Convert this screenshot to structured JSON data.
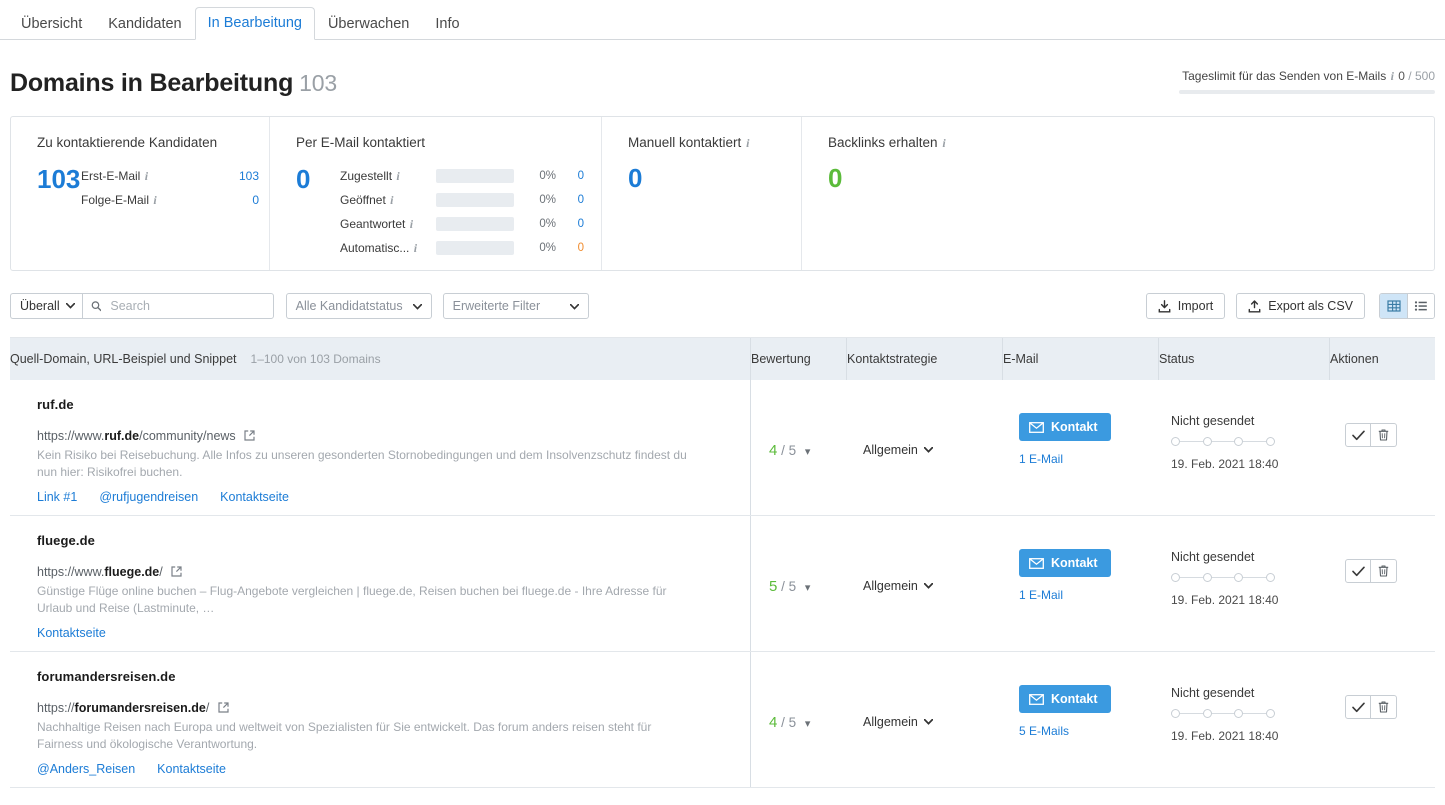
{
  "tabs": [
    {
      "label": "Übersicht",
      "active": false
    },
    {
      "label": "Kandidaten",
      "active": false
    },
    {
      "label": "In Bearbeitung",
      "active": true
    },
    {
      "label": "Überwachen",
      "active": false
    },
    {
      "label": "Info",
      "active": false
    }
  ],
  "header": {
    "title": "Domains in Bearbeitung",
    "count": "103",
    "daily_limit_label": "Tageslimit für das Senden von E-Mails",
    "daily_limit_value": "0",
    "daily_limit_sep": "/",
    "daily_limit_total": "500"
  },
  "stats": {
    "to_contact": {
      "title": "Zu kontaktierende Kandidaten",
      "big": "103",
      "rows": [
        {
          "label": "Erst-E-Mail",
          "value": "103"
        },
        {
          "label": "Folge-E-Mail",
          "value": "0"
        }
      ]
    },
    "by_email": {
      "title": "Per E-Mail kontaktiert",
      "big": "0",
      "rows": [
        {
          "label": "Zugestellt",
          "pct": "0%",
          "value": "0",
          "orange": false
        },
        {
          "label": "Geöffnet",
          "pct": "0%",
          "value": "0",
          "orange": false
        },
        {
          "label": "Geantwortet",
          "pct": "0%",
          "value": "0",
          "orange": false
        },
        {
          "label": "Automatisc...",
          "pct": "0%",
          "value": "0",
          "orange": true
        }
      ]
    },
    "manual": {
      "title": "Manuell kontaktiert",
      "big": "0"
    },
    "backlinks": {
      "title": "Backlinks erhalten",
      "big": "0"
    }
  },
  "toolbar": {
    "scope_label": "Überall",
    "search_placeholder": "Search",
    "search_value": "",
    "status_filter": "Alle Kandidatstatus",
    "advanced_filter": "Erweiterte Filter",
    "import_label": "Import",
    "export_label": "Export als CSV",
    "view_grid": "grid-view",
    "view_list": "list-view"
  },
  "table": {
    "columns": {
      "domain": "Quell-Domain, URL-Beispiel und Snippet",
      "domain_sub": "1–100 von 103 Domains",
      "rating": "Bewertung",
      "strategy": "Kontaktstrategie",
      "email": "E-Mail",
      "status": "Status",
      "actions": "Aktionen"
    },
    "rows": [
      {
        "domain": "ruf.de",
        "url_prefix": "https://www.",
        "url_bold": "ruf.de",
        "url_suffix": "/community/news",
        "snippet": "Kein Risiko bei Reisebuchung. Alle Infos zu unseren gesonderten Stornobedingungen und dem Insolvenzschutz findest du nun hier: Risikofrei buchen.",
        "links": [
          "Link #1",
          "@rufjugendreisen",
          "Kontaktseite"
        ],
        "rating_value": "4",
        "rating_max": "/ 5",
        "strategy": "Allgemein",
        "contact_label": "Kontakt",
        "mail_count": "1 E-Mail",
        "status_label": "Nicht gesendet",
        "status_date": "19. Feb. 2021 18:40"
      },
      {
        "domain": "fluege.de",
        "url_prefix": "https://www.",
        "url_bold": "fluege.de",
        "url_suffix": "/",
        "snippet": "Günstige Flüge online buchen – Flug-Angebote vergleichen | fluege.de, Reisen buchen bei fluege.de - Ihre Adresse für Urlaub und Reise (Lastminute, …",
        "links": [
          "Kontaktseite"
        ],
        "rating_value": "5",
        "rating_max": "/ 5",
        "strategy": "Allgemein",
        "contact_label": "Kontakt",
        "mail_count": "1 E-Mail",
        "status_label": "Nicht gesendet",
        "status_date": "19. Feb. 2021 18:40"
      },
      {
        "domain": "forumandersreisen.de",
        "url_prefix": "https://",
        "url_bold": "forumandersreisen.de",
        "url_suffix": "/",
        "snippet": "Nachhaltige Reisen nach Europa und weltweit von Spezialisten für Sie entwickelt. Das forum anders reisen steht für Fairness und ökologische Verantwortung.",
        "links": [
          "@Anders_Reisen",
          "Kontaktseite"
        ],
        "rating_value": "4",
        "rating_max": "/ 5",
        "strategy": "Allgemein",
        "contact_label": "Kontakt",
        "mail_count": "5 E-Mails",
        "status_label": "Nicht gesendet",
        "status_date": "19. Feb. 2021 18:40"
      }
    ]
  },
  "colors": {
    "accent_blue": "#1c7cd6",
    "button_blue": "#3b9ae0",
    "green": "#5bbb3a",
    "orange": "#f08c2e",
    "header_bg": "#e9eef3"
  }
}
